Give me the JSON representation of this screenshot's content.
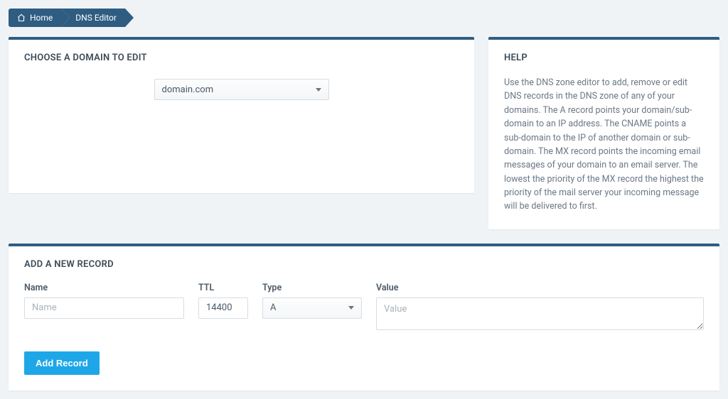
{
  "breadcrumbs": {
    "home": "Home",
    "current": "DNS Editor"
  },
  "domain_panel": {
    "title": "CHOOSE A DOMAIN TO EDIT",
    "selected_domain": "domain.com"
  },
  "help_panel": {
    "title": "HELP",
    "body": "Use the DNS zone editor to add, remove or edit DNS records in the DNS zone of any of your domains. The A record points your domain/sub-domain to an IP address. The CNAME points a sub-domain to the IP of another domain or sub-domain. The MX record points the incoming email messages of your domain to an email server. The lowest the priority of the MX record the highest the priority of the mail server your incoming message will be delivered to first."
  },
  "add_record_panel": {
    "title": "ADD A NEW RECORD",
    "labels": {
      "name": "Name",
      "ttl": "TTL",
      "type": "Type",
      "value": "Value"
    },
    "placeholders": {
      "name": "Name",
      "value": "Value"
    },
    "values": {
      "ttl": "14400",
      "type": "A"
    },
    "button": "Add Record"
  }
}
